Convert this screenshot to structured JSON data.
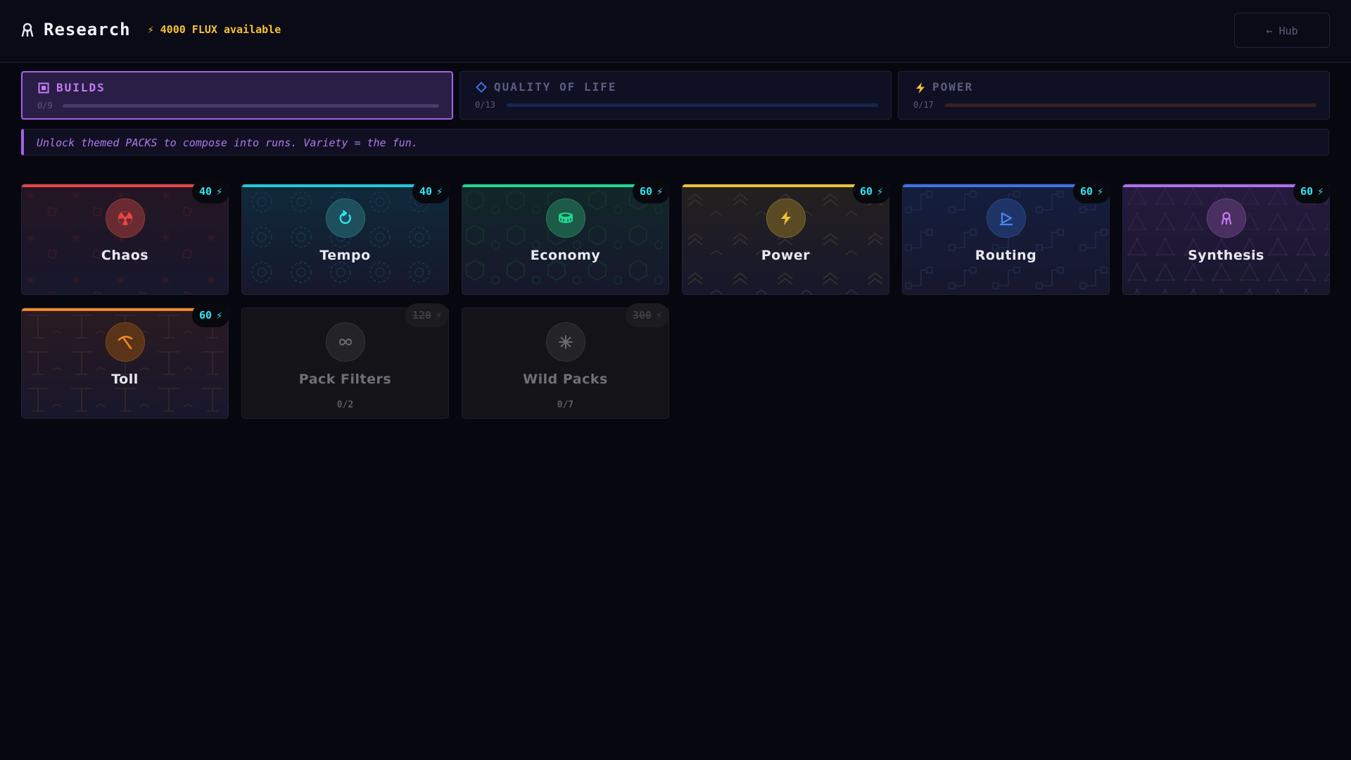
{
  "header": {
    "title": "Research",
    "flux_label": "⚡ 4000 FLUX available",
    "hub_label": "← Hub"
  },
  "tabs": [
    {
      "label": "BUILDS",
      "count": "0/9",
      "progress": 0,
      "color": "#c27cf0",
      "icon": "square-dot-icon",
      "active": true
    },
    {
      "label": "QUALITY OF LIFE",
      "count": "0/13",
      "progress": 0,
      "color": "#3f6ee0",
      "icon": "diamond-icon",
      "active": false
    },
    {
      "label": "POWER",
      "count": "0/17",
      "progress": 0,
      "color": "#f5c232",
      "icon": "lightning-icon",
      "active": false
    }
  ],
  "hint": "Unlock themed PACKS to compose into runs. Variety = the fun.",
  "packs": [
    {
      "name": "Chaos",
      "cost": "40",
      "color": "#e84444",
      "icon": "radioactive-icon",
      "locked": false
    },
    {
      "name": "Tempo",
      "cost": "40",
      "color": "#22c8d8",
      "icon": "rotate-icon",
      "locked": false
    },
    {
      "name": "Economy",
      "cost": "60",
      "color": "#20d890",
      "icon": "coins-icon",
      "locked": false
    },
    {
      "name": "Power",
      "cost": "60",
      "color": "#f0c03a",
      "icon": "lightning-icon",
      "locked": false
    },
    {
      "name": "Routing",
      "cost": "60",
      "color": "#3d74e6",
      "icon": "route-icon",
      "locked": false
    },
    {
      "name": "Synthesis",
      "cost": "60",
      "color": "#b070ee",
      "icon": "flask-icon",
      "locked": false
    },
    {
      "name": "Toll",
      "cost": "60",
      "color": "#f08a24",
      "icon": "pickaxe-icon",
      "locked": false
    },
    {
      "name": "Pack Filters",
      "cost": "120",
      "sub": "0/2",
      "color": "#6a6a72",
      "icon": "infinity-icon",
      "locked": true
    },
    {
      "name": "Wild Packs",
      "cost": "300",
      "sub": "0/7",
      "color": "#6a6a72",
      "icon": "asterisk-icon",
      "locked": true
    }
  ],
  "bolt_glyph": "⚡"
}
